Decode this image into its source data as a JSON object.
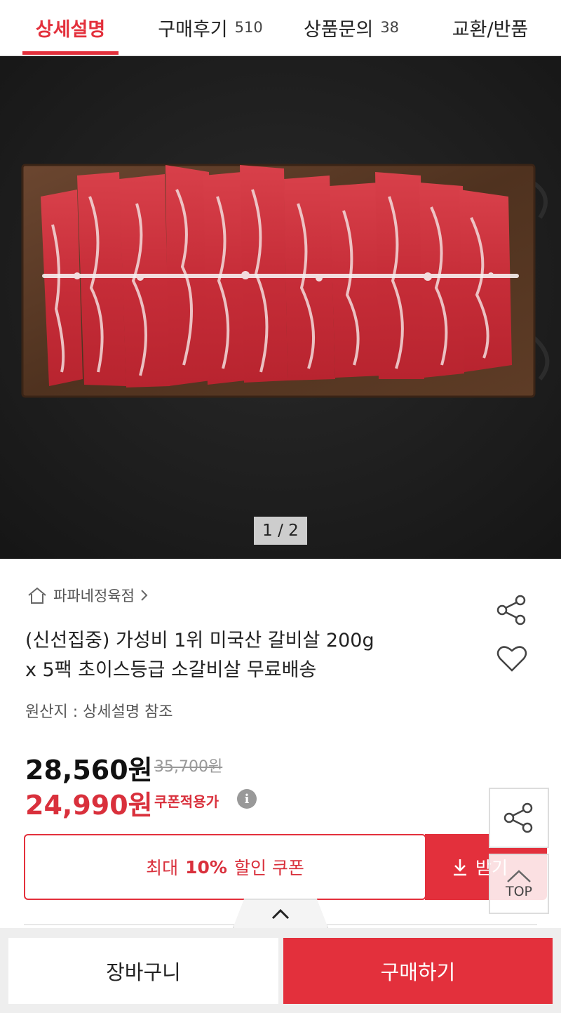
{
  "tabs": [
    {
      "label": "상세설명",
      "count": ""
    },
    {
      "label": "구매후기",
      "count": "510"
    },
    {
      "label": "상품문의",
      "count": "38"
    },
    {
      "label": "교환/반품",
      "count": ""
    }
  ],
  "active_tab": "상세설명",
  "image": {
    "indicator": "1 / 2",
    "subject": "raw marbled beef short rib slices on a wooden board, dark slate background",
    "colors": {
      "background": "#1d1d1d",
      "board": "#5a3a24",
      "meat": "#c9313b",
      "fat": "#f1d9d9"
    }
  },
  "product": {
    "store": "파파네정육점",
    "title_line1": "(신선집중) 가성비 1위 미국산 갈비살 200g",
    "title_line2": "x 5팩 초이스등급 소갈비살 무료배송",
    "origin": "원산지 : 상세설명 참조",
    "price": "28,560원",
    "original_price": "35,700원",
    "coupon_price": "24,990원",
    "coupon_price_label": "쿠폰적용가",
    "info_icon_glyph": "i"
  },
  "coupon": {
    "prefix": "최대",
    "highlight": "10%",
    "suffix": "할인 쿠폰",
    "receive_label": "받기"
  },
  "floating": {
    "top_label": "TOP"
  },
  "bottom": {
    "cart_label": "장바구니",
    "buy_label": "구매하기"
  },
  "accent_color": "#e3303c"
}
